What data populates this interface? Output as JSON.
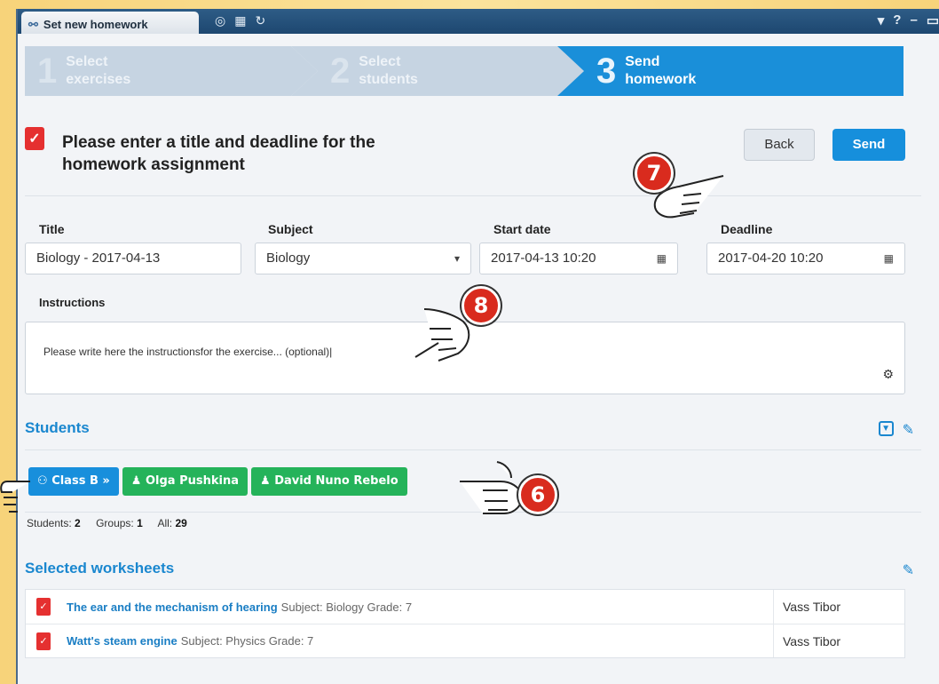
{
  "window": {
    "tab_title": "Set new homework"
  },
  "wizard": {
    "steps": [
      {
        "number": "1",
        "line1": "Select",
        "line2": "exercises",
        "active": false
      },
      {
        "number": "2",
        "line1": "Select",
        "line2": "students",
        "active": false
      },
      {
        "number": "3",
        "line1": "Send",
        "line2": "homework",
        "active": true
      }
    ]
  },
  "header": {
    "line1": "Please enter a title and deadline for the",
    "line2": "homework assignment",
    "back_label": "Back",
    "send_label": "Send"
  },
  "form": {
    "title_label": "Title",
    "title_value": "Biology - 2017-04-13",
    "subject_label": "Subject",
    "subject_value": "Biology",
    "start_label": "Start date",
    "start_value": "2017-04-13 10:20",
    "deadline_label": "Deadline",
    "deadline_value": "2017-04-20 10:20",
    "instructions_label": "Instructions",
    "instructions_value": "Please write here the instructionsfor the exercise... (optional)|"
  },
  "students": {
    "title": "Students",
    "chips": [
      {
        "label": "Class B »",
        "kind": "group"
      },
      {
        "label": "Olga Pushkina",
        "kind": "student"
      },
      {
        "label": "David Nuno Rebelo",
        "kind": "student"
      }
    ],
    "counts": {
      "students_label": "Students:",
      "students_value": "2",
      "groups_label": "Groups:",
      "groups_value": "1",
      "all_label": "All:",
      "all_value": "29"
    }
  },
  "worksheets": {
    "title": "Selected worksheets",
    "rows": [
      {
        "name": "The ear and the mechanism of hearing",
        "meta": "Subject: Biology Grade: 7",
        "author": "Vass Tibor"
      },
      {
        "name": "Watt's steam engine",
        "meta": "Subject: Physics Grade: 7",
        "author": "Vass Tibor"
      }
    ]
  },
  "callouts": {
    "m6": "6",
    "m7": "7",
    "m8": "8"
  },
  "colors": {
    "accent": "#1a8fd9",
    "green": "#25b35a",
    "red": "#e53030",
    "background": "#f7d37a"
  }
}
